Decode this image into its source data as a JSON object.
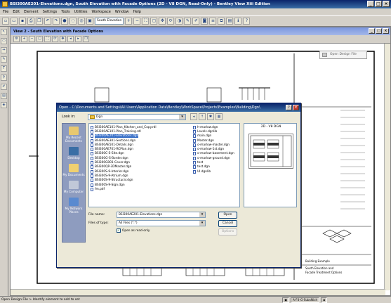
{
  "app": {
    "title": "BSI300AE201-Elevations.dgn, South Elevation with Facade Options (2D - V8 DGN, Read-Only) - Bentley View Xiii Edition"
  },
  "menu": [
    "File",
    "Edit",
    "Element",
    "Settings",
    "Tools",
    "Utilities",
    "Workspace",
    "Window",
    "Help"
  ],
  "toolbar": {
    "view_select": "South Elevation"
  },
  "view": {
    "title": "View 2 - South Elevation with Facade Options"
  },
  "drawing": {
    "titleblock_lines": [
      "Building Example",
      "South Elevation and",
      "Facade Treatment Options"
    ]
  },
  "palette": {
    "label": "Open Design File"
  },
  "dialog": {
    "title": "Open - C:\\Documents and Settings\\All Users\\Application Data\\Bentley\\WorkSpace\\Projects\\Examples\\Building\\Dgn\\",
    "look_in_label": "Look in:",
    "look_in_value": "Dgn",
    "places": [
      "My Recent Documents",
      "Desktop",
      "My Documents",
      "My Computer",
      "My Network Places"
    ],
    "files_col1": [
      "BSI300AE101-Plan_Kitchen_and_Copy.rdl",
      "BSI300AE101-Plan_Training.rdl",
      "BSI300AE201-Elevations.dgn",
      "BSI300AE301-Sections.dgn",
      "BSI300AE501-Details.dgn",
      "BSI300AE701-RCPlan.dgn",
      "BSI300C-S-Site.dgn",
      "BSI300G-S-Border.dgn",
      "BSI300G001-Cover.dgn",
      "BSI300QP-3DMaster.dgn",
      "BSI300S-9-Interior.dgn",
      "BSI300S-9-Atrium.dgn",
      "BSI300S-9-Structural.dgn",
      "BSI300S-9-Sign.dgn",
      "fm.pdf"
    ],
    "files_col2": [
      "h-marlow.dgn",
      "Levels.dgnlib",
      "main.dgn",
      "Master.dgn",
      "o-marlow-master.dgn",
      "o-marlow-1st.dgn",
      "o-marlow-basement.dgn",
      "o-marlow-ground.dgn",
      "test",
      "test.dgn",
      "UI.dgnlib"
    ],
    "selected_file": "BSI300AE201-Elevations.dgn",
    "preview_label": "2D - V8 DGN",
    "filename_label": "File name:",
    "filename_value": "BSI300AE201-Elevations.dgn",
    "filetype_label": "Files of type:",
    "filetype_value": "All Files (*.*)",
    "readonly_label": "Open as read-only",
    "readonly_checked": true,
    "open_label": "Open",
    "cancel_label": "Cancel",
    "options_label": "Options"
  },
  "statusbar": {
    "left": "Open Design File > Identify element to add to set",
    "level": "A-F4-G-SubsNich"
  }
}
